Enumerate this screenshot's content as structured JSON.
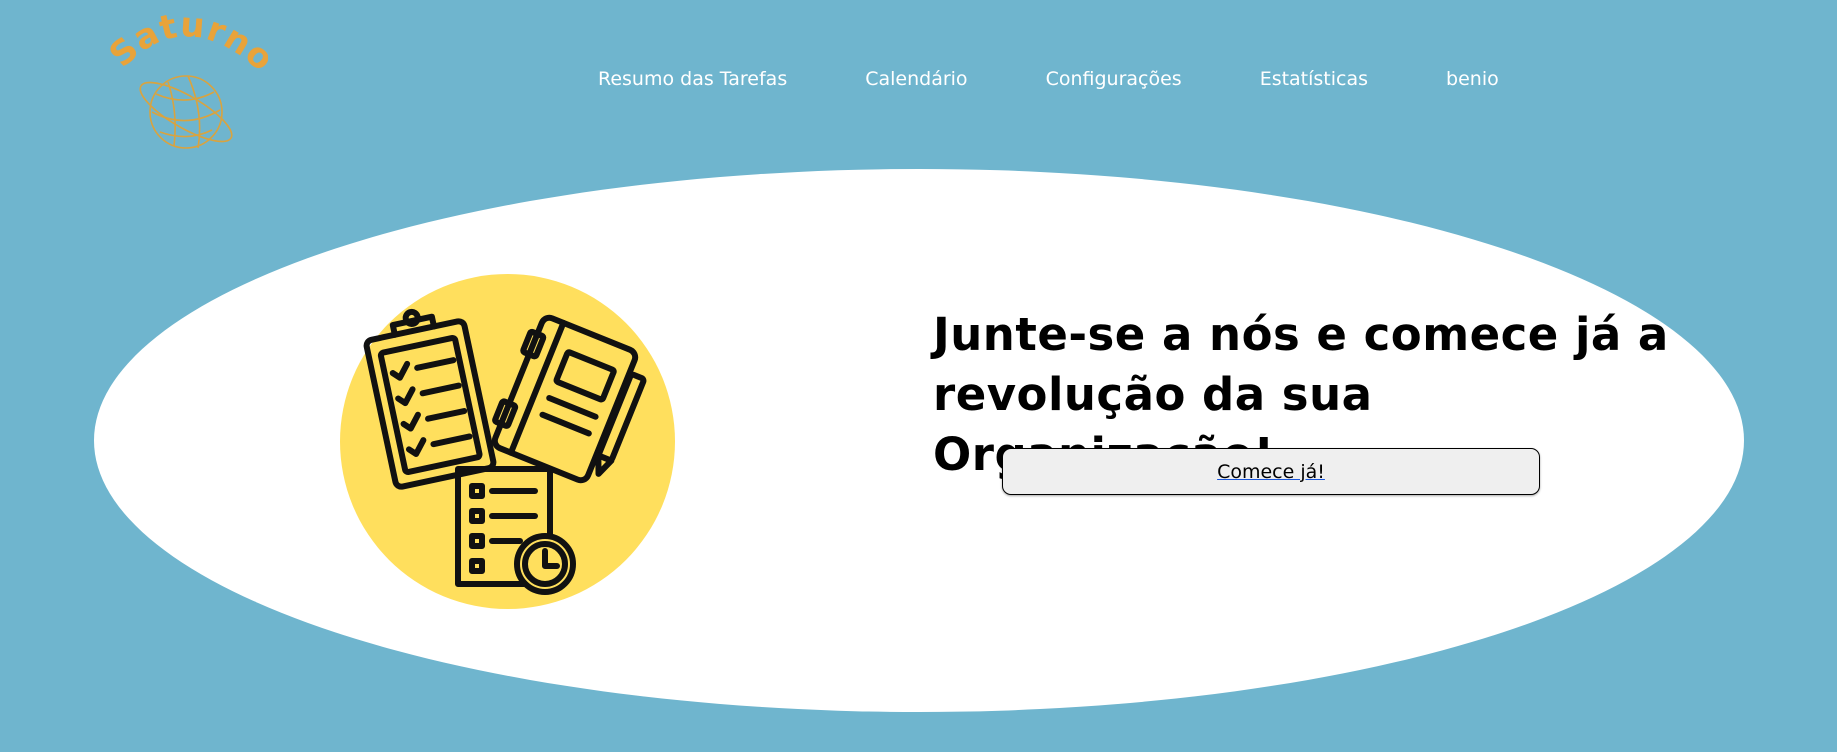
{
  "brand": {
    "name": "Saturno",
    "logo_icon": "saturn-planet-icon",
    "color": "#e8a33a"
  },
  "nav": {
    "items": [
      {
        "label": "Resumo das Tarefas"
      },
      {
        "label": "Calendário"
      },
      {
        "label": "Configurações"
      },
      {
        "label": "Estatísticas"
      },
      {
        "label": "benio"
      }
    ]
  },
  "hero": {
    "illustration_icon": "task-planning-icon",
    "headline": "Junte-se a nós e comece já a revolução da sua Organização!",
    "cta_label": "Comece já!"
  },
  "colors": {
    "background": "#6fb5ce",
    "hero": "#ffffff",
    "illustration_circle": "#ffdf5d",
    "nav_text": "#ffffff"
  }
}
